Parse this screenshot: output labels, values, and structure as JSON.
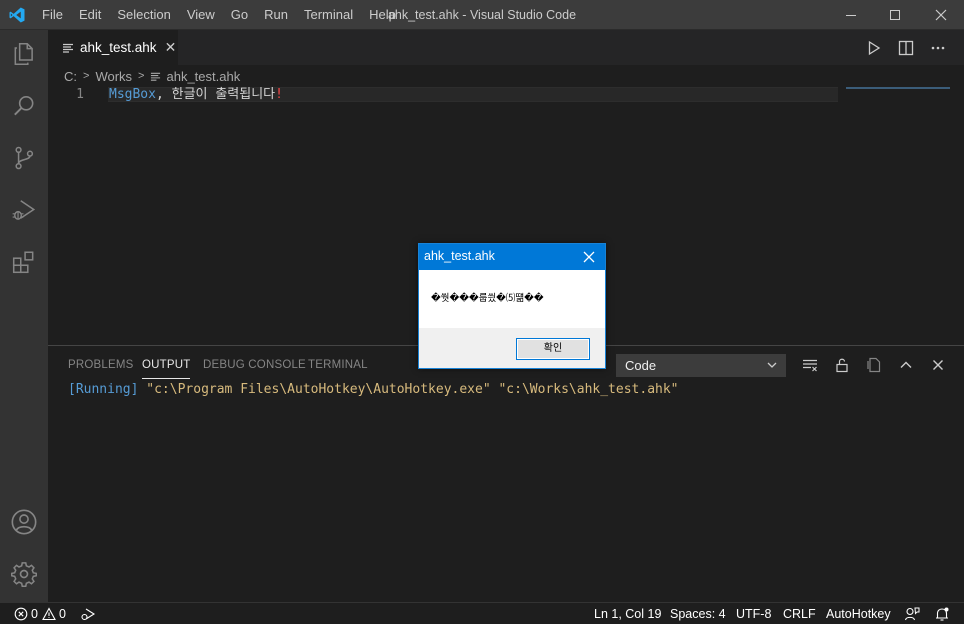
{
  "titlebar": {
    "menu": [
      "File",
      "Edit",
      "Selection",
      "View",
      "Go",
      "Run",
      "Terminal",
      "Help"
    ],
    "window_title": "ahk_test.ahk - Visual Studio Code"
  },
  "activity_bar": {
    "items": [
      "explorer-icon",
      "search-icon",
      "source-control-icon",
      "run-debug-icon",
      "extensions-icon"
    ],
    "bottom": [
      "account-icon",
      "manage-gear-icon"
    ]
  },
  "editor": {
    "tab": {
      "label": "ahk_test.ahk",
      "close": "✕"
    },
    "breadcrumb": {
      "root": "C:",
      "folder": "Works",
      "file": "ahk_test.ahk"
    },
    "line_number": "1",
    "code": {
      "command": "MsgBox",
      "text": ", 한글이 출력됩니다",
      "error_char": "!"
    }
  },
  "panel": {
    "tabs": [
      "PROBLEMS",
      "OUTPUT",
      "DEBUG CONSOLE",
      "TERMINAL"
    ],
    "active_tab": "OUTPUT",
    "channel": "Code",
    "output": {
      "running": "[Running]",
      "command": "\"c:\\Program Files\\AutoHotkey\\AutoHotkey.exe\"",
      "arg": "\"c:\\Works\\ahk_test.ahk\""
    }
  },
  "statusbar": {
    "errors": "0",
    "warnings": "0",
    "cursor": "Ln 1, Col 19",
    "spaces": "Spaces: 4",
    "encoding": "UTF-8",
    "eol": "CRLF",
    "language": "AutoHotkey"
  },
  "dialog": {
    "title": "ahk_test.ahk",
    "message": "�쒓���룹씠�⑸떎��",
    "ok": "확인"
  },
  "colors": {
    "accent": "#0078d7",
    "keyword": "#569cd6",
    "string": "#ce9178",
    "error": "#f44747"
  }
}
